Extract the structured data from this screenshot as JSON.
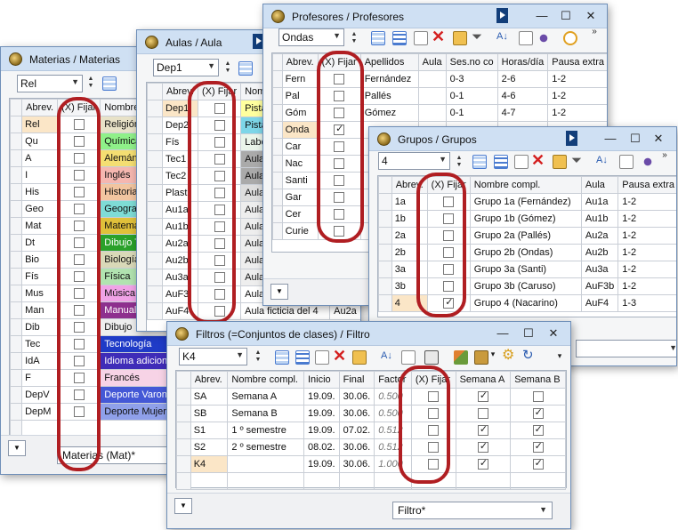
{
  "materias": {
    "title": "Materias / Materias",
    "select_value": "Rel",
    "headers": [
      "Abrev.",
      "(X) Fijar",
      "Nombre"
    ],
    "rows": [
      {
        "abbr": "Rel",
        "name": "Religión",
        "color": "#e8e2c8",
        "checked": false,
        "active": true
      },
      {
        "abbr": "Qu",
        "name": "Química",
        "color": "#8ff089",
        "checked": false
      },
      {
        "abbr": "A",
        "name": "Alemán",
        "color": "#f4de72",
        "checked": false
      },
      {
        "abbr": "I",
        "name": "Inglés",
        "color": "#f5b7b0",
        "checked": false
      },
      {
        "abbr": "His",
        "name": "Historia",
        "color": "#f2c5a0",
        "checked": false
      },
      {
        "abbr": "Geo",
        "name": "Geografía",
        "color": "#7edcd6",
        "checked": false
      },
      {
        "abbr": "Mat",
        "name": "Matemáticas",
        "color": "#e0c13a",
        "checked": false
      },
      {
        "abbr": "Dt",
        "name": "Dibujo Técnico",
        "color": "#2aa12a",
        "checked": false
      },
      {
        "abbr": "Bio",
        "name": "Biología",
        "color": "#d9d9b8",
        "checked": false
      },
      {
        "abbr": "Fís",
        "name": "Física",
        "color": "#b1e3b0",
        "checked": false
      },
      {
        "abbr": "Mus",
        "name": "Música",
        "color": "#f0a3e6",
        "checked": false
      },
      {
        "abbr": "Man",
        "name": "Manualidades",
        "color": "#8e2f8e",
        "checked": false
      },
      {
        "abbr": "Dib",
        "name": "Dibujo",
        "color": "#eeeeee",
        "checked": false
      },
      {
        "abbr": "Tec",
        "name": "Tecnología",
        "color": "#1f3bc7",
        "checked": false
      },
      {
        "abbr": "IdA",
        "name": "Idioma adicional",
        "color": "#3f2cb8",
        "checked": false
      },
      {
        "abbr": "F",
        "name": "Francés",
        "color": "#f7d3e6",
        "checked": false
      },
      {
        "abbr": "DepV",
        "name": "Deporte Varones",
        "color": "#4458d6",
        "checked": false
      },
      {
        "abbr": "DepM",
        "name": "Deporte Mujeres",
        "color": "#8fa0ea",
        "checked": false
      }
    ],
    "bottom_combo": "Materias (Mat)*"
  },
  "aulas": {
    "title": "Aulas / Aula",
    "select_value": "Dep1",
    "headers": [
      "Abrev.",
      "(X) Fijar",
      "Nombre"
    ],
    "rows": [
      {
        "abbr": "Dep1",
        "name": "Pista",
        "checked": false,
        "active": true,
        "color": "#ffff9e"
      },
      {
        "abbr": "Dep2",
        "name": "Pista",
        "checked": false,
        "color": "#7dd6e8"
      },
      {
        "abbr": "Fís",
        "name": "Laboratorio",
        "checked": false,
        "color": "#eaf5ea"
      },
      {
        "abbr": "Tec1",
        "name": "Aula",
        "checked": false,
        "color": "#aaaaaa"
      },
      {
        "abbr": "Tec2",
        "name": "Aula",
        "checked": false,
        "color": "#aaaaaa"
      },
      {
        "abbr": "Plast",
        "name": "Aula",
        "checked": false,
        "color": "#dddddd"
      },
      {
        "abbr": "Au1a",
        "name": "Aula",
        "checked": false,
        "color": "#eeeeee"
      },
      {
        "abbr": "Au1b",
        "name": "Aula",
        "checked": false,
        "color": "#eeeeee"
      },
      {
        "abbr": "Au2a",
        "name": "Aula",
        "checked": false,
        "color": "#eeeeee"
      },
      {
        "abbr": "Au2b",
        "name": "Aula",
        "checked": false,
        "color": "#eeeeee"
      },
      {
        "abbr": "Au3a",
        "name": "Aula",
        "checked": false,
        "color": "#eeeeee"
      },
      {
        "abbr": "AuF3",
        "name": "Aula ficticia del 3",
        "checked": false,
        "color": "#ffffff"
      },
      {
        "abbr": "AuF4",
        "name": "Aula ficticia del 4",
        "extra": "Au2a",
        "checked": false,
        "color": "#ffffff"
      }
    ]
  },
  "profesores": {
    "title": "Profesores / Profesores",
    "select_value": "Ondas",
    "headers": [
      "Abrev.",
      "(X) Fijar",
      "Apellidos",
      "Aula",
      "Ses.no co",
      "Horas/día",
      "Pausa extra"
    ],
    "rows": [
      {
        "abbr": "Fern",
        "apellidos": "Fernández",
        "aula": "",
        "ses": "0-3",
        "horas": "2-6",
        "pausa": "1-2",
        "checked": false
      },
      {
        "abbr": "Pal",
        "apellidos": "Pallés",
        "aula": "",
        "ses": "0-1",
        "horas": "4-6",
        "pausa": "1-2",
        "checked": false
      },
      {
        "abbr": "Góm",
        "apellidos": "Gómez",
        "aula": "",
        "ses": "0-1",
        "horas": "4-7",
        "pausa": "1-2",
        "checked": false
      },
      {
        "abbr": "Onda",
        "apellidos": "",
        "aula": "",
        "ses": "",
        "horas": "",
        "pausa": "",
        "checked": true,
        "active": true
      },
      {
        "abbr": "Car",
        "apellidos": "",
        "aula": "",
        "ses": "",
        "horas": "",
        "pausa": "",
        "checked": false
      },
      {
        "abbr": "Nac",
        "apellidos": "",
        "aula": "",
        "ses": "",
        "horas": "",
        "pausa": "",
        "checked": false
      },
      {
        "abbr": "Santi",
        "apellidos": "",
        "aula": "",
        "ses": "",
        "horas": "",
        "pausa": "",
        "checked": false
      },
      {
        "abbr": "Gar",
        "apellidos": "",
        "aula": "",
        "ses": "",
        "horas": "",
        "pausa": "",
        "checked": false
      },
      {
        "abbr": "Cer",
        "apellidos": "",
        "aula": "",
        "ses": "",
        "horas": "",
        "pausa": "",
        "checked": false
      },
      {
        "abbr": "Curie",
        "apellidos": "",
        "aula": "",
        "ses": "",
        "horas": "",
        "pausa": "",
        "checked": false
      }
    ]
  },
  "grupos": {
    "title": "Grupos / Grupos",
    "select_value": "4",
    "headers": [
      "Abrev.",
      "(X) Fijar",
      "Nombre compl.",
      "Aula",
      "Pausa extra"
    ],
    "rows": [
      {
        "abbr": "1a",
        "name": "Grupo 1a (Fernández)",
        "aula": "Au1a",
        "pausa": "1-2",
        "checked": false
      },
      {
        "abbr": "1b",
        "name": "Grupo 1b (Gómez)",
        "aula": "Au1b",
        "pausa": "1-2",
        "checked": false
      },
      {
        "abbr": "2a",
        "name": "Grupo 2a (Pallés)",
        "aula": "Au2a",
        "pausa": "1-2",
        "checked": false
      },
      {
        "abbr": "2b",
        "name": "Grupo 2b (Ondas)",
        "aula": "Au2b",
        "pausa": "1-2",
        "checked": false
      },
      {
        "abbr": "3a",
        "name": "Grupo 3a (Santi)",
        "aula": "Au3a",
        "pausa": "1-2",
        "checked": false
      },
      {
        "abbr": "3b",
        "name": "Grupo 3b (Caruso)",
        "aula": "AuF3b",
        "pausa": "1-2",
        "checked": false
      },
      {
        "abbr": "4",
        "name": "Grupo 4 (Nacarino)",
        "aula": "AuF4",
        "pausa": "1-3",
        "checked": true,
        "active": true
      }
    ]
  },
  "filtros": {
    "title": "Filtros (=Conjuntos de clases) / Filtro",
    "select_value": "K4",
    "headers": [
      "Abrev.",
      "Nombre compl.",
      "Inicio",
      "Final",
      "Factor",
      "(X) Fijar",
      "Semana A",
      "Semana B"
    ],
    "rows": [
      {
        "abbr": "SA",
        "name": "Semana A",
        "inicio": "19.09.",
        "final": "30.06.",
        "factor": "0.500",
        "fijar": false,
        "a": true,
        "b": false
      },
      {
        "abbr": "SB",
        "name": "Semana B",
        "inicio": "19.09.",
        "final": "30.06.",
        "factor": "0.500",
        "fijar": false,
        "a": false,
        "b": true
      },
      {
        "abbr": "S1",
        "name": "1 º semestre",
        "inicio": "19.09.",
        "final": "07.02.",
        "factor": "0.512",
        "fijar": false,
        "a": true,
        "b": true
      },
      {
        "abbr": "S2",
        "name": "2 º semestre",
        "inicio": "08.02.",
        "final": "30.06.",
        "factor": "0.512",
        "fijar": false,
        "a": true,
        "b": true
      },
      {
        "abbr": "K4",
        "name": "",
        "inicio": "19.09.",
        "final": "30.06.",
        "factor": "1.000",
        "fijar": false,
        "a": true,
        "b": true,
        "active": true
      }
    ],
    "bottom_combo": "Filtro*"
  },
  "colors": {
    "highlight": "#b01e22",
    "active_row": "#fbe6c7",
    "titlebar": "#cfe0f3"
  }
}
